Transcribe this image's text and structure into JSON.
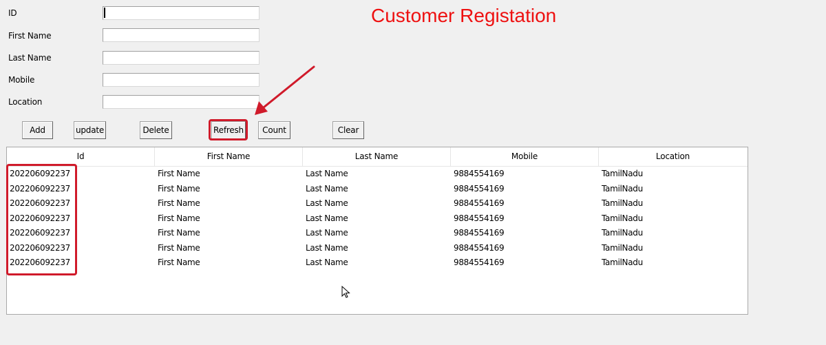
{
  "title": "Customer Registation",
  "form": {
    "fields": [
      {
        "label": "ID",
        "value": ""
      },
      {
        "label": "First Name",
        "value": ""
      },
      {
        "label": "Last Name",
        "value": ""
      },
      {
        "label": "Mobile",
        "value": ""
      },
      {
        "label": "Location",
        "value": ""
      }
    ]
  },
  "buttons": {
    "add": "Add",
    "update": "update",
    "delete": "Delete",
    "refresh": "Refresh",
    "count": "Count",
    "clear": "Clear"
  },
  "table": {
    "columns": [
      "Id",
      "First Name",
      "Last Name",
      "Mobile",
      "Location"
    ],
    "rows": [
      [
        "202206092237",
        "First Name",
        "Last Name",
        "9884554169",
        "TamilNadu"
      ],
      [
        "202206092237",
        "First Name",
        "Last Name",
        "9884554169",
        "TamilNadu"
      ],
      [
        "202206092237",
        "First Name",
        "Last Name",
        "9884554169",
        "TamilNadu"
      ],
      [
        "202206092237",
        "First Name",
        "Last Name",
        "9884554169",
        "TamilNadu"
      ],
      [
        "202206092237",
        "First Name",
        "Last Name",
        "9884554169",
        "TamilNadu"
      ],
      [
        "202206092237",
        "First Name",
        "Last Name",
        "9884554169",
        "TamilNadu"
      ],
      [
        "202206092237",
        "First Name",
        "Last Name",
        "9884554169",
        "TamilNadu"
      ]
    ]
  },
  "colors": {
    "title": "#ee1111",
    "annotation": "#d01a2a",
    "window_background": "#f0f0f0"
  },
  "icons": {
    "annotation_arrow": "arrow-icon",
    "mouse_pointer": "mouse-cursor-icon"
  }
}
